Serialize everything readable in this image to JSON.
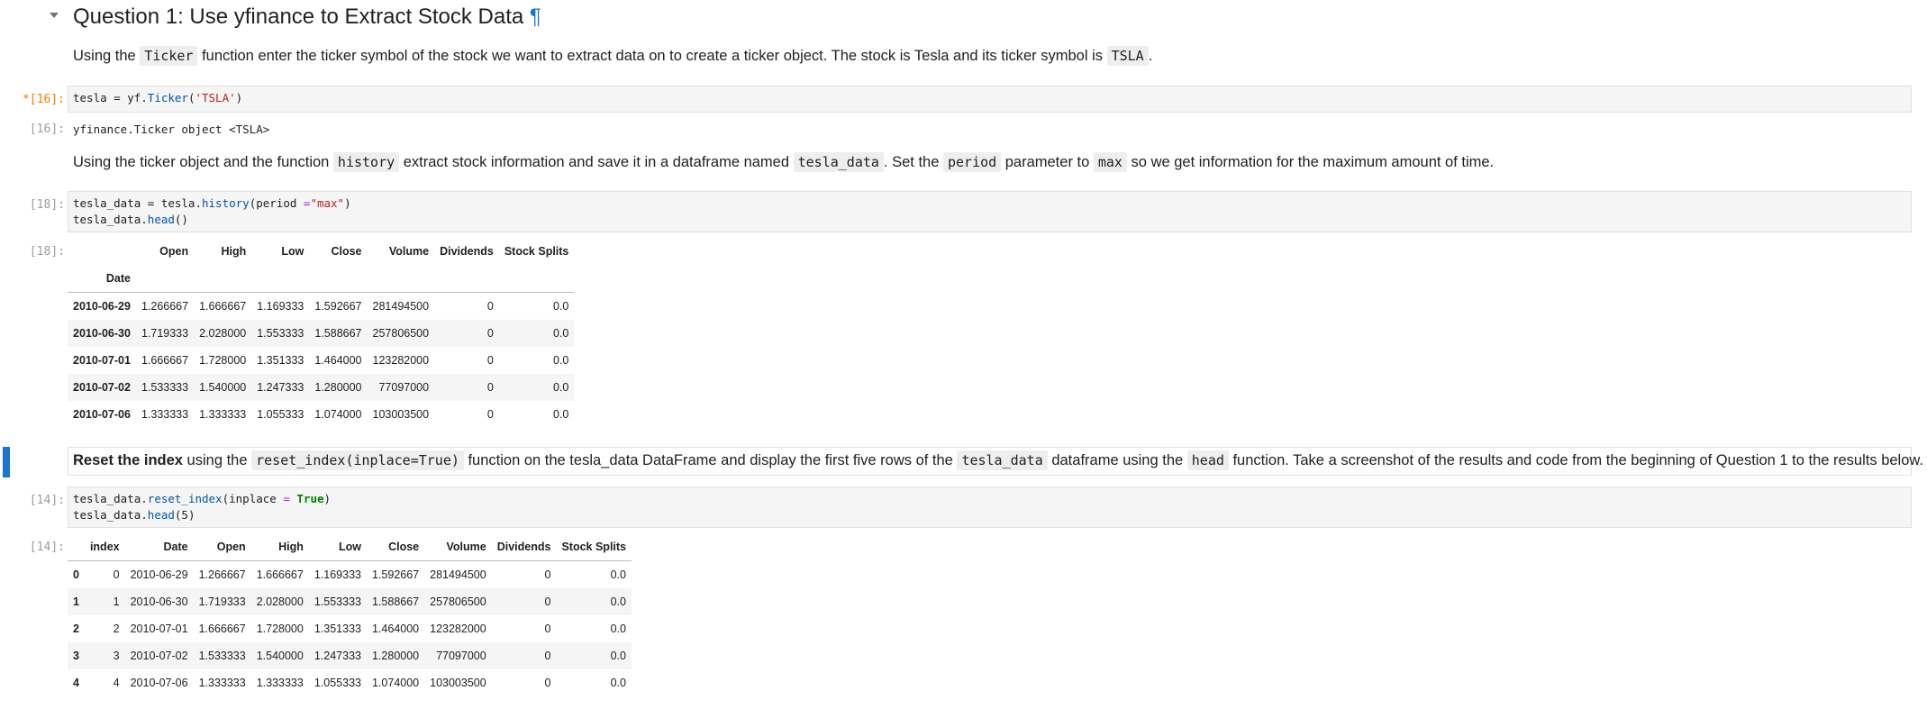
{
  "heading": {
    "title": "Question 1: Use yfinance to Extract Stock Data",
    "anchor": "¶"
  },
  "md1": {
    "t1": "Using the ",
    "c1": "Ticker",
    "t2": " function enter the ticker symbol of the stock we want to extract data on to create a ticker object. The stock is Tesla and its ticker symbol is ",
    "c2": "TSLA",
    "t3": "."
  },
  "cell16": {
    "prompt": "*[16]:",
    "out_prompt": "[16]:",
    "code": {
      "var": "tesla",
      "eq": " = yf.",
      "fn": "Ticker",
      "open": "(",
      "str": "'TSLA'",
      "close": ")"
    },
    "output": "yfinance.Ticker object <TSLA>"
  },
  "md2": {
    "t1": "Using the ticker object and the function ",
    "c1": "history",
    "t2": " extract stock information and save it in a dataframe named ",
    "c2": "tesla_data",
    "t3": ". Set the ",
    "c3": "period",
    "t4": " parameter to ",
    "c4": "max",
    "t5": " so we get information for the maximum amount of time."
  },
  "cell18": {
    "prompt": "[18]:",
    "out_prompt": "[18]:",
    "line1": {
      "a": "tesla_data = tesla.",
      "fn": "history",
      "b": "(period ",
      "op": "=",
      "str": "\"max\"",
      "c": ")"
    },
    "line2": {
      "a": "tesla_data.",
      "fn": "head",
      "b": "()"
    }
  },
  "table1": {
    "columns": [
      "Open",
      "High",
      "Low",
      "Close",
      "Volume",
      "Dividends",
      "Stock Splits"
    ],
    "index_name": "Date",
    "rows": [
      {
        "idx": "2010-06-29",
        "cells": [
          "1.266667",
          "1.666667",
          "1.169333",
          "1.592667",
          "281494500",
          "0",
          "0.0"
        ]
      },
      {
        "idx": "2010-06-30",
        "cells": [
          "1.719333",
          "2.028000",
          "1.553333",
          "1.588667",
          "257806500",
          "0",
          "0.0"
        ]
      },
      {
        "idx": "2010-07-01",
        "cells": [
          "1.666667",
          "1.728000",
          "1.351333",
          "1.464000",
          "123282000",
          "0",
          "0.0"
        ]
      },
      {
        "idx": "2010-07-02",
        "cells": [
          "1.533333",
          "1.540000",
          "1.247333",
          "1.280000",
          "77097000",
          "0",
          "0.0"
        ]
      },
      {
        "idx": "2010-07-06",
        "cells": [
          "1.333333",
          "1.333333",
          "1.055333",
          "1.074000",
          "103003500",
          "0",
          "0.0"
        ]
      }
    ]
  },
  "md3": {
    "b1": "Reset the index",
    "t1": " using the ",
    "c1": "reset_index(inplace=True)",
    "t2": " function on the tesla_data DataFrame and display the first five rows of the ",
    "c2": "tesla_data",
    "t3": " dataframe using the ",
    "c3": "head",
    "t4": " function. Take a screenshot of the results and code from the beginning of Question 1 to the results below."
  },
  "cell14": {
    "prompt": "[14]:",
    "out_prompt": "[14]:",
    "line1": {
      "a": "tesla_data.",
      "fn": "reset_index",
      "b": "(inplace ",
      "op": "=",
      "sp": " ",
      "kw": "True",
      "c": ")"
    },
    "line2": {
      "a": "tesla_data.",
      "fn": "head",
      "b": "(5)"
    }
  },
  "table2": {
    "columns": [
      "index",
      "Date",
      "Open",
      "High",
      "Low",
      "Close",
      "Volume",
      "Dividends",
      "Stock Splits"
    ],
    "rows": [
      {
        "idx": "0",
        "cells": [
          "0",
          "2010-06-29",
          "1.266667",
          "1.666667",
          "1.169333",
          "1.592667",
          "281494500",
          "0",
          "0.0"
        ]
      },
      {
        "idx": "1",
        "cells": [
          "1",
          "2010-06-30",
          "1.719333",
          "2.028000",
          "1.553333",
          "1.588667",
          "257806500",
          "0",
          "0.0"
        ]
      },
      {
        "idx": "2",
        "cells": [
          "2",
          "2010-07-01",
          "1.666667",
          "1.728000",
          "1.351333",
          "1.464000",
          "123282000",
          "0",
          "0.0"
        ]
      },
      {
        "idx": "3",
        "cells": [
          "3",
          "2010-07-02",
          "1.533333",
          "1.540000",
          "1.247333",
          "1.280000",
          "77097000",
          "0",
          "0.0"
        ]
      },
      {
        "idx": "4",
        "cells": [
          "4",
          "2010-07-06",
          "1.333333",
          "1.333333",
          "1.055333",
          "1.074000",
          "103003500",
          "0",
          "0.0"
        ]
      }
    ]
  },
  "colors": {
    "active_cell_bar": "#1976d2",
    "busy_prompt": "#f57c00"
  },
  "icons": {
    "collapse": "caret-down-icon",
    "anchor": "pilcrow-icon"
  }
}
